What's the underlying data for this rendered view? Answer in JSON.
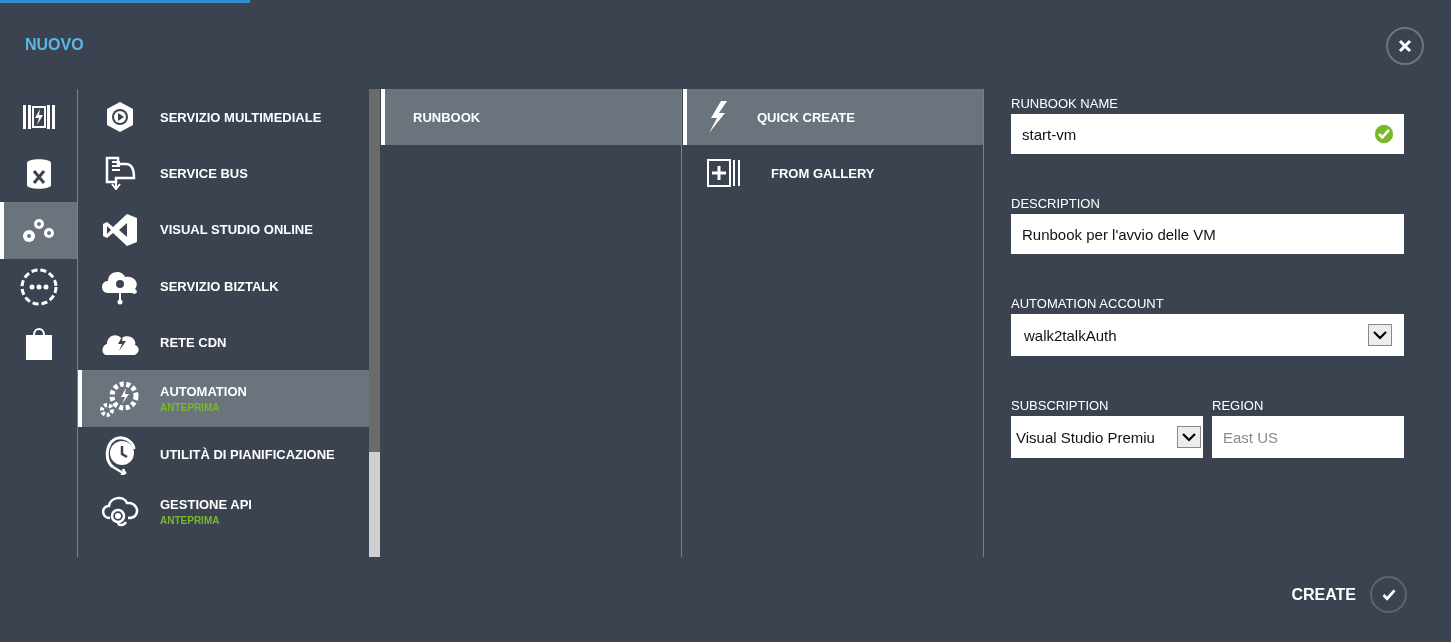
{
  "header": {
    "title": "NUOVO"
  },
  "categories": [
    {
      "selected": false
    },
    {
      "selected": false
    },
    {
      "selected": true
    },
    {
      "selected": false
    },
    {
      "selected": false
    }
  ],
  "services": [
    {
      "label": "SERVIZIO MULTIMEDIALE",
      "selected": false
    },
    {
      "label": "SERVICE BUS",
      "selected": false
    },
    {
      "label": "VISUAL STUDIO ONLINE",
      "selected": false
    },
    {
      "label": "SERVIZIO BIZTALK",
      "selected": false
    },
    {
      "label": "RETE CDN",
      "selected": false
    },
    {
      "label": "AUTOMATION",
      "badge": "ANTEPRIMA",
      "selected": true
    },
    {
      "label": "UTILITÀ DI PIANIFICAZIONE",
      "selected": false
    },
    {
      "label": "GESTIONE API",
      "badge": "ANTEPRIMA",
      "selected": false
    }
  ],
  "item_types": [
    {
      "label": "RUNBOOK",
      "selected": true
    }
  ],
  "create_options": [
    {
      "label": "QUICK CREATE",
      "selected": true
    },
    {
      "label": "FROM GALLERY",
      "selected": false
    }
  ],
  "form": {
    "runbook_name": {
      "label": "RUNBOOK NAME",
      "value": "start-vm",
      "valid": true
    },
    "description": {
      "label": "DESCRIPTION",
      "value": "Runbook per l'avvio delle VM"
    },
    "automation_account": {
      "label": "AUTOMATION ACCOUNT",
      "value": "walk2talkAuth"
    },
    "subscription": {
      "label": "SUBSCRIPTION",
      "value": "Visual Studio Premiu"
    },
    "region": {
      "label": "REGION",
      "placeholder": "East US"
    }
  },
  "footer": {
    "create_label": "CREATE"
  }
}
